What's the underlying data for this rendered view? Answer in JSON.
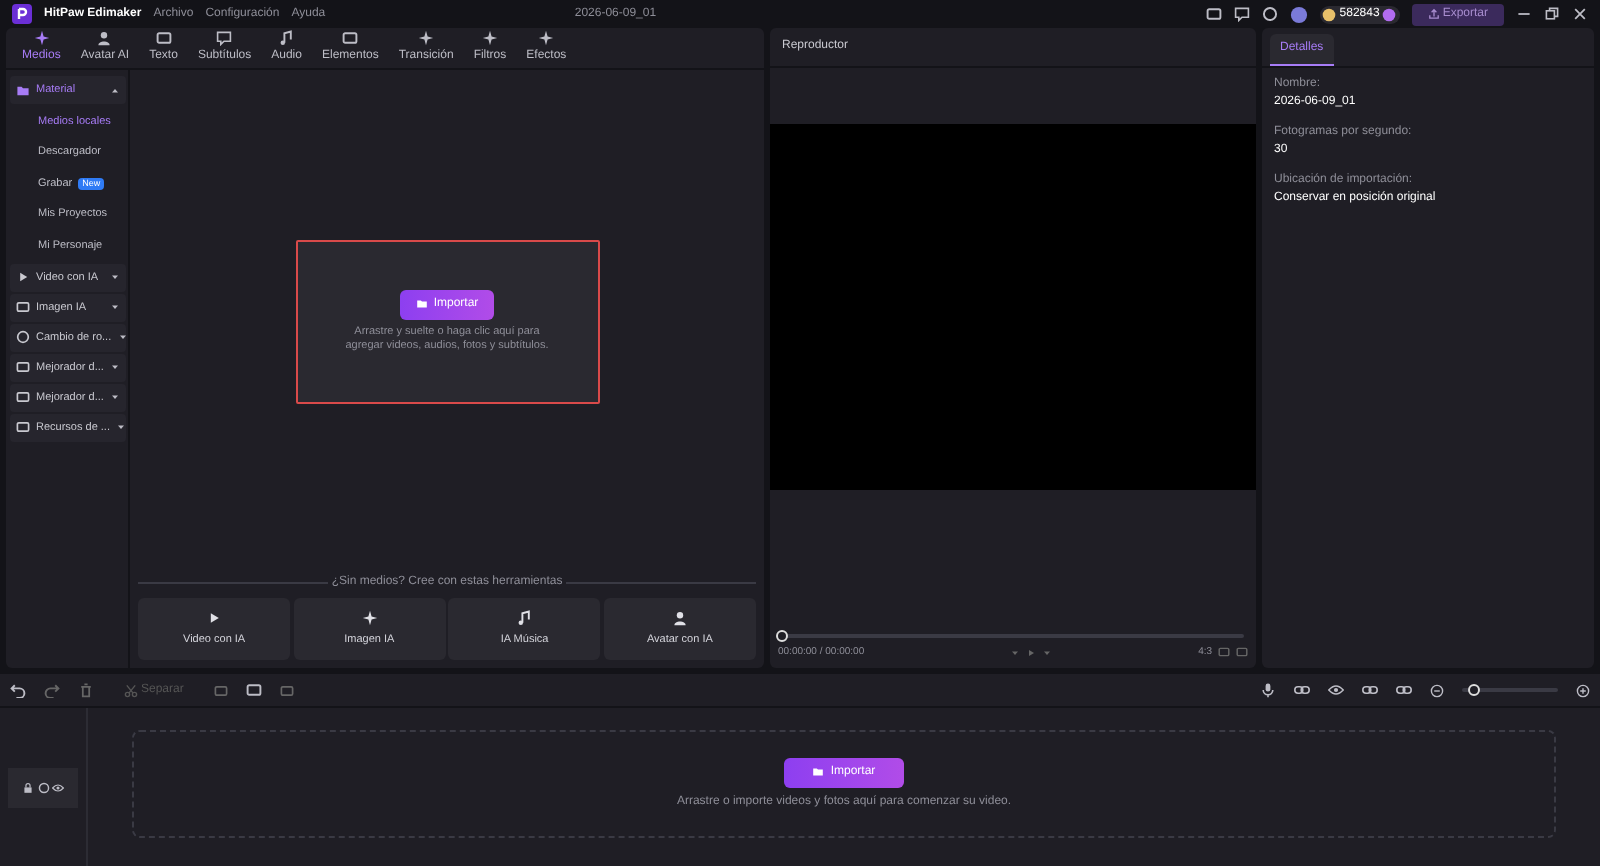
{
  "app": {
    "name": "HitPaw Edimaker",
    "menu": [
      "Archivo",
      "Configuración",
      "Ayuda"
    ],
    "project_title": "2026-06-09_01",
    "coins": "582843",
    "export_label": "Exportar"
  },
  "tabs": [
    {
      "label": "Medios",
      "selected": true
    },
    {
      "label": "Avatar AI",
      "selected": false
    },
    {
      "label": "Texto",
      "selected": false
    },
    {
      "label": "Subtítulos",
      "selected": false
    },
    {
      "label": "Audio",
      "selected": false
    },
    {
      "label": "Elementos",
      "selected": false
    },
    {
      "label": "Transición",
      "selected": false
    },
    {
      "label": "Filtros",
      "selected": false
    },
    {
      "label": "Efectos",
      "selected": false
    }
  ],
  "sidebar": {
    "items": [
      {
        "label": "Material",
        "expanded": true,
        "children": [
          {
            "label": "Medios locales",
            "selected": true
          },
          {
            "label": "Descargador",
            "selected": false
          },
          {
            "label": "Grabar",
            "selected": false,
            "badge": "New"
          },
          {
            "label": "Mis Proyectos",
            "selected": false
          },
          {
            "label": "Mi Personaje",
            "selected": false
          }
        ]
      },
      {
        "label": "Video con IA",
        "expanded": false
      },
      {
        "label": "Imagen IA",
        "expanded": false
      },
      {
        "label": "Cambio de ro...",
        "expanded": false
      },
      {
        "label": "Mejorador d...",
        "expanded": false
      },
      {
        "label": "Mejorador d...",
        "expanded": false
      },
      {
        "label": "Recursos de ...",
        "expanded": false
      }
    ]
  },
  "media": {
    "import_label": "Importar",
    "hint": "Arrastre y suelte o haga clic aquí para agregar videos, audios, fotos y subtítulos.",
    "tools_caption": "¿Sin medios? Cree con estas herramientas",
    "tools": [
      {
        "label": "Video con IA"
      },
      {
        "label": "Imagen IA"
      },
      {
        "label": "IA Música"
      },
      {
        "label": "Avatar con IA"
      }
    ]
  },
  "player": {
    "title": "Reproductor",
    "level": 0,
    "time": "00:00:00 / 00:00:00",
    "ratio": "4:3"
  },
  "details": {
    "tab": "Detalles",
    "fields": [
      {
        "label": "Nombre:",
        "value": "2026-06-09_01"
      },
      {
        "label": "Fotogramas por segundo:",
        "value": "30"
      },
      {
        "label": "Ubicación de importación:",
        "value": "Conservar en posición original"
      }
    ]
  },
  "timeline": {
    "split_label": "Separar",
    "zoom": {
      "level": 0.12
    },
    "import_label": "Importar",
    "hint": "Arrastre o importe videos y fotos aquí para comenzar su video."
  }
}
